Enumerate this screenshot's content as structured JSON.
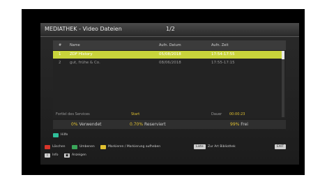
{
  "header": {
    "title": "MEDIATHEK - Video Dateien",
    "page": "1/2"
  },
  "list": {
    "columns": {
      "index": "#",
      "name": "Name",
      "date": "Aufn. Datum",
      "time": "Aufn. Zeit"
    },
    "rows": [
      {
        "index": "1",
        "name": "ZDF HIstory",
        "date": "05/08/2018",
        "time": "17:54-17:55",
        "selected": true
      },
      {
        "index": "2",
        "name": "gut, frühe & Co.",
        "date": "08/06/2018",
        "time": "17:55-17:15",
        "selected": false
      }
    ]
  },
  "status": {
    "service_label": "Fortlel des Services",
    "service_value": "Start",
    "duration_label": "Dauer",
    "duration_value": "00:00:23"
  },
  "storage": {
    "used_pct": "0%",
    "used_label": "Verwendet",
    "reserved_pct": "0.70%",
    "reserved_label": "Reserviert",
    "free_pct": "99%",
    "free_label": "Frei"
  },
  "footer": {
    "help_label": "Hilfe",
    "red_label": "Löschen",
    "green_label": "Umbenen",
    "yellow_label": "Markieren / Markierung aufheben",
    "list_key": "Liste",
    "list_label": "Zur Art Bibliothek",
    "exit_key": "EXIT",
    "info_glyph": "i",
    "info_label": "Info",
    "show_glyph": "▣",
    "show_label": "Anzeigen"
  },
  "colors": {
    "red": "#d8352a",
    "green": "#3aa65a",
    "yellow": "#e0c030",
    "help_green": "#2fbf9a",
    "selected_row": "#c9d43b"
  }
}
